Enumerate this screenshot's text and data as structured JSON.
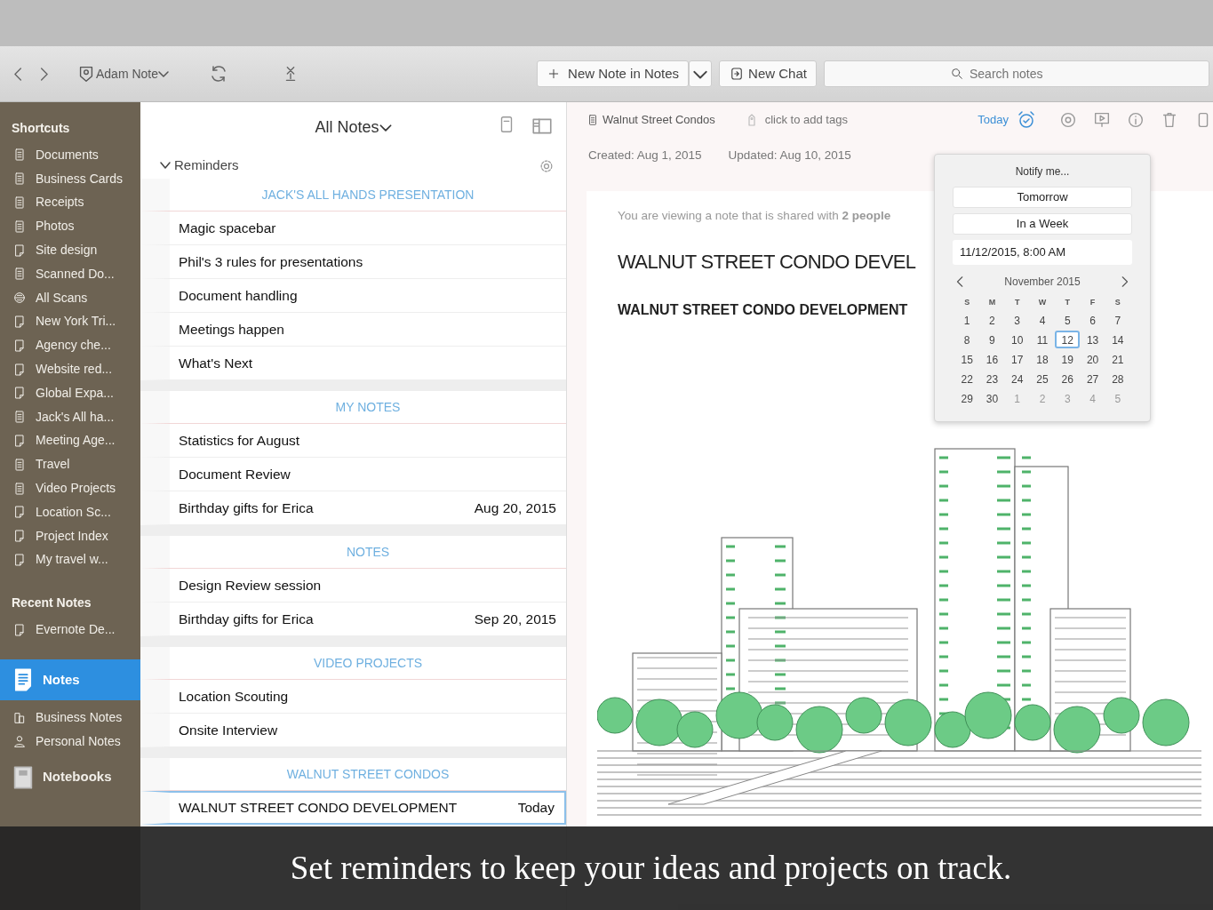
{
  "toolbar": {
    "account": "Adam Note",
    "new_note": "New Note in Notes",
    "new_chat": "New Chat",
    "search": {
      "placeholder": "Search notes"
    }
  },
  "sidebar": {
    "shortcuts_title": "Shortcuts",
    "shortcuts": [
      {
        "label": "Documents",
        "kind": "notebook"
      },
      {
        "label": "Business Cards",
        "kind": "notebook"
      },
      {
        "label": "Receipts",
        "kind": "notebook"
      },
      {
        "label": "Photos",
        "kind": "notebook"
      },
      {
        "label": "Site design",
        "kind": "note"
      },
      {
        "label": "Scanned Do...",
        "kind": "notebook"
      },
      {
        "label": "All Scans",
        "kind": "scan"
      },
      {
        "label": "New York Tri...",
        "kind": "note"
      },
      {
        "label": "Agency che...",
        "kind": "note"
      },
      {
        "label": "Website red...",
        "kind": "note"
      },
      {
        "label": "Global Expa...",
        "kind": "note"
      },
      {
        "label": "Jack's All ha...",
        "kind": "notebook"
      },
      {
        "label": "Meeting Age...",
        "kind": "note"
      },
      {
        "label": "Travel",
        "kind": "notebook"
      },
      {
        "label": "Video Projects",
        "kind": "notebook"
      },
      {
        "label": "Location Sc...",
        "kind": "note"
      },
      {
        "label": "Project Index",
        "kind": "note"
      },
      {
        "label": "My travel w...",
        "kind": "note"
      }
    ],
    "recent_title": "Recent Notes",
    "recent": [
      {
        "label": "Evernote De...",
        "kind": "note"
      }
    ],
    "main": [
      {
        "label": "Notes",
        "kind": "notes",
        "selected": true
      },
      {
        "label": "Business Notes",
        "kind": "business",
        "selected": false
      },
      {
        "label": "Personal Notes",
        "kind": "person",
        "selected": false
      },
      {
        "label": "Notebooks",
        "kind": "notebooks",
        "selected": false
      }
    ]
  },
  "note_list": {
    "title": "All Notes",
    "group": "Reminders",
    "sections": [
      {
        "header": "JACK'S ALL HANDS PRESENTATION",
        "notes": [
          {
            "title": "Magic spacebar",
            "selected": false
          },
          {
            "title": "Phil's 3 rules for presentations",
            "selected": false
          },
          {
            "title": "Document handling",
            "selected": false
          },
          {
            "title": "Meetings happen",
            "selected": false
          },
          {
            "title": "What's Next",
            "selected": false
          }
        ]
      },
      {
        "header": "MY NOTES",
        "notes": [
          {
            "title": "Statistics for August",
            "selected": false
          },
          {
            "title": "Document Review",
            "selected": false
          },
          {
            "title": "Birthday gifts for Erica",
            "date": "Aug 20, 2015",
            "selected": false
          }
        ]
      },
      {
        "header": "NOTES",
        "notes": [
          {
            "title": "Design Review session",
            "selected": false
          },
          {
            "title": "Birthday gifts for Erica",
            "date": "Sep 20, 2015",
            "selected": false
          }
        ]
      },
      {
        "header": "VIDEO PROJECTS",
        "notes": [
          {
            "title": "Location Scouting",
            "selected": false
          },
          {
            "title": "Onsite Interview",
            "selected": false
          }
        ]
      },
      {
        "header": "WALNUT STREET CONDOS",
        "notes": [
          {
            "title": "WALNUT STREET CONDO DEVELOPMENT",
            "date": "Today",
            "selected": true
          }
        ]
      }
    ]
  },
  "editor": {
    "notebook": "Walnut Street Condos",
    "tags": {
      "placeholder": "click to add tags"
    },
    "reminder": "Today",
    "reminder_on": true,
    "created": "Created: Aug 1, 2015",
    "updated": "Updated: Aug 10, 2015",
    "shared_notice": "You are viewing a note that is shared with **2 people**",
    "title": "WALNUT STREET CONDO DEVEL",
    "heading": "WALNUT STREET CONDO DEVELOPMENT"
  },
  "reminder_popup": {
    "title": "Notify me...",
    "options": [
      "Tomorrow",
      "In a Week"
    ],
    "datetime": "11/12/2015,  8:00 AM",
    "month": "November 2015",
    "weekdays": [
      "S",
      "M",
      "T",
      "W",
      "T",
      "F",
      "S"
    ],
    "weeks": [
      [
        {
          "day": "1",
          "muted": false,
          "selected": false
        },
        {
          "day": "2",
          "muted": false,
          "selected": false
        },
        {
          "day": "3",
          "muted": false,
          "selected": false
        },
        {
          "day": "4",
          "muted": false,
          "selected": false
        },
        {
          "day": "5",
          "muted": false,
          "selected": false
        },
        {
          "day": "6",
          "muted": false,
          "selected": false
        },
        {
          "day": "7",
          "muted": false,
          "selected": false
        }
      ],
      [
        {
          "day": "8",
          "muted": false,
          "selected": false
        },
        {
          "day": "9",
          "muted": false,
          "selected": false
        },
        {
          "day": "10",
          "muted": false,
          "selected": false
        },
        {
          "day": "11",
          "muted": false,
          "selected": false
        },
        {
          "day": "12",
          "muted": false,
          "selected": true
        },
        {
          "day": "13",
          "muted": false,
          "selected": false
        },
        {
          "day": "14",
          "muted": false,
          "selected": false
        }
      ],
      [
        {
          "day": "15",
          "muted": false,
          "selected": false
        },
        {
          "day": "16",
          "muted": false,
          "selected": false
        },
        {
          "day": "17",
          "muted": false,
          "selected": false
        },
        {
          "day": "18",
          "muted": false,
          "selected": false
        },
        {
          "day": "19",
          "muted": false,
          "selected": false
        },
        {
          "day": "20",
          "muted": false,
          "selected": false
        },
        {
          "day": "21",
          "muted": false,
          "selected": false
        }
      ],
      [
        {
          "day": "22",
          "muted": false,
          "selected": false
        },
        {
          "day": "23",
          "muted": false,
          "selected": false
        },
        {
          "day": "24",
          "muted": false,
          "selected": false
        },
        {
          "day": "25",
          "muted": false,
          "selected": false
        },
        {
          "day": "26",
          "muted": false,
          "selected": false
        },
        {
          "day": "27",
          "muted": false,
          "selected": false
        },
        {
          "day": "28",
          "muted": false,
          "selected": false
        }
      ],
      [
        {
          "day": "29",
          "muted": false,
          "selected": false
        },
        {
          "day": "30",
          "muted": false,
          "selected": false
        },
        {
          "day": "1",
          "muted": true,
          "selected": false
        },
        {
          "day": "2",
          "muted": true,
          "selected": false
        },
        {
          "day": "3",
          "muted": true,
          "selected": false
        },
        {
          "day": "4",
          "muted": true,
          "selected": false
        },
        {
          "day": "5",
          "muted": true,
          "selected": false
        }
      ]
    ]
  },
  "caption": "Set reminders to keep your ideas and projects on track."
}
